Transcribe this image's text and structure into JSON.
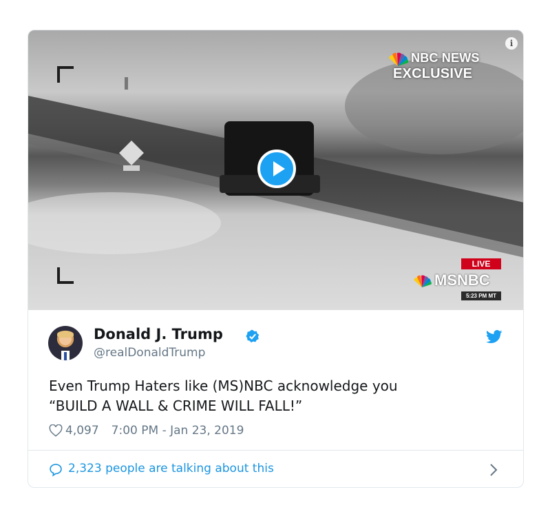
{
  "media": {
    "nbc_badge_line1": "NBC NEWS",
    "nbc_badge_line2": "EXCLUSIVE",
    "info_icon": "i",
    "live_badge": "LIVE",
    "network_logo": "MSNBC",
    "timestamp_badge": "5:23 PM MT"
  },
  "tweet": {
    "display_name": "Donald J. Trump",
    "handle": "@realDonaldTrump",
    "text_line1": "Even Trump Haters like (MS)NBC acknowledge you",
    "text_line2": "“BUILD A WALL & CRIME WILL FALL!”",
    "like_count": "4,097",
    "timestamp": "7:00 PM - Jan 23, 2019"
  },
  "footer": {
    "talking_text": "2,323 people are talking about this"
  },
  "colors": {
    "accent": "#1da1f2",
    "link": "#1b95e0",
    "secondary_text": "#657786",
    "live_red": "#d0021b"
  },
  "icons": [
    "info-icon",
    "play-icon",
    "peacock-icon",
    "verified-icon",
    "twitter-bird-icon",
    "heart-icon",
    "comment-icon",
    "chevron-right-icon"
  ]
}
